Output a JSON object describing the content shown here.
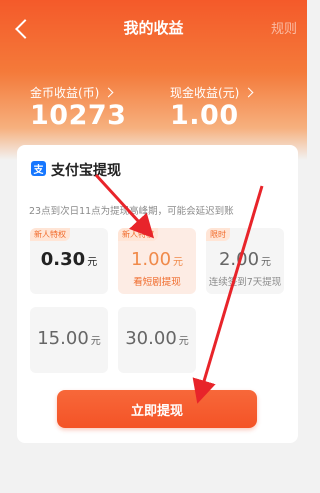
{
  "header": {
    "title": "我的收益",
    "rules_label": "规则",
    "coin_label": "金币收益(币)",
    "coin_value": "10273",
    "cash_label": "现金收益(元)",
    "cash_value": "1.00"
  },
  "card": {
    "title": "支付宝提现",
    "notice": "23点到次日11点为提现高峰期，可能会延迟到账",
    "options": [
      {
        "badge": "新人特权",
        "amount": "0.30",
        "unit": "元",
        "sub": ""
      },
      {
        "badge": "新人特权",
        "amount": "1.00",
        "unit": "元",
        "sub": "看短剧提现"
      },
      {
        "badge": "限时",
        "amount": "2.00",
        "unit": "元",
        "sub": "连续签到7天提现"
      },
      {
        "badge": "",
        "amount": "15.00",
        "unit": "元",
        "sub": ""
      },
      {
        "badge": "",
        "amount": "30.00",
        "unit": "元",
        "sub": ""
      }
    ],
    "button_label": "立即提现"
  },
  "colors": {
    "accent": "#f45a2a",
    "arrow": "#e8242a",
    "alipay": "#1677ff"
  }
}
